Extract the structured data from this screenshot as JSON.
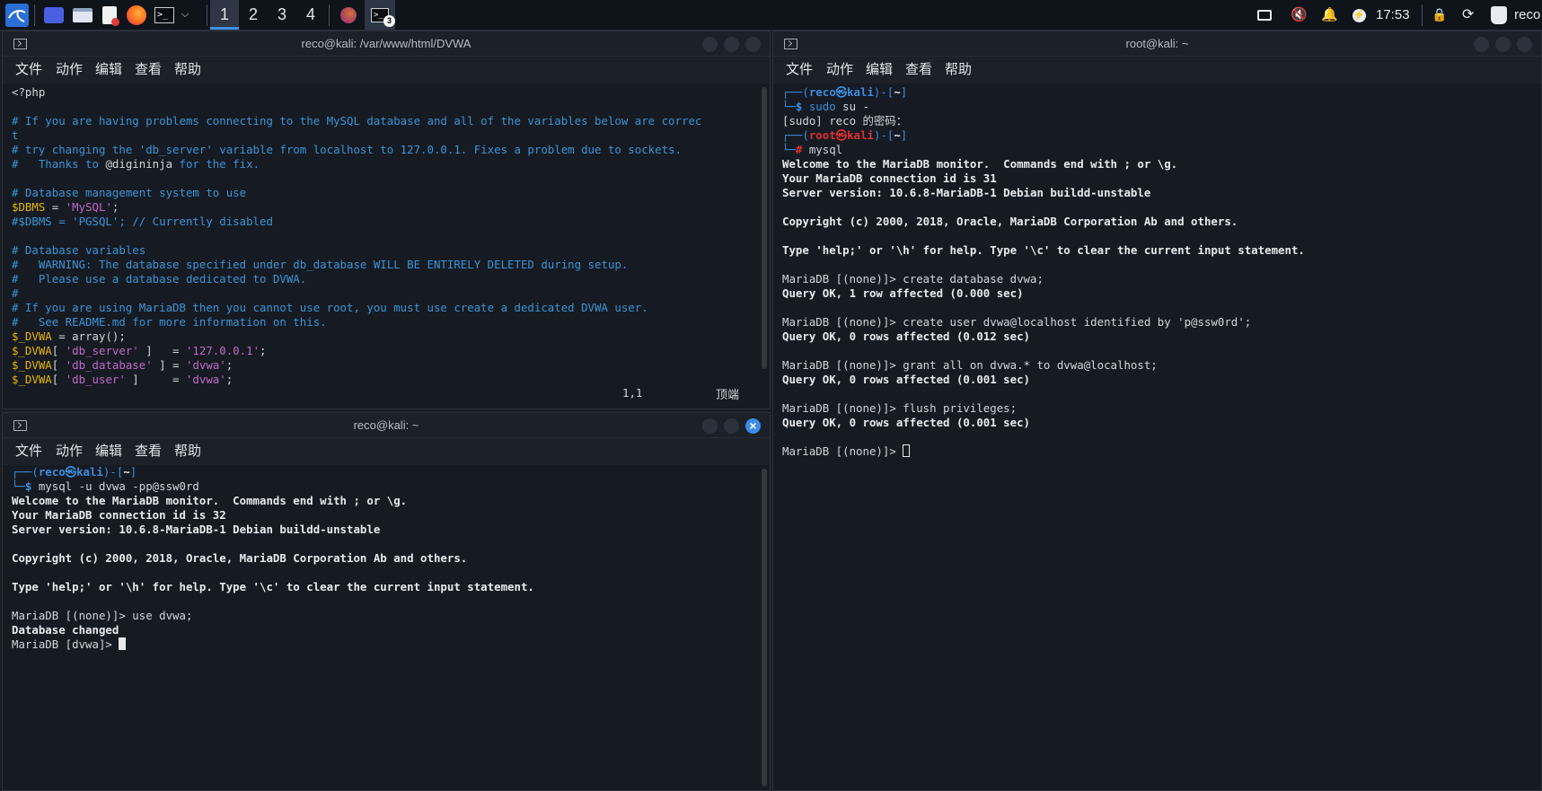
{
  "colors": {
    "accent": "#3f8fe8",
    "comment": "#3a95d6",
    "variable": "#e6b800",
    "string": "#c06ac9",
    "root_prompt": "#e03030"
  },
  "taskbar": {
    "apps": [
      "kali-menu-icon",
      "desktop-icon",
      "file-manager-icon",
      "text-editor-icon",
      "firefox-icon",
      "terminal-icon"
    ],
    "workspaces": [
      "1",
      "2",
      "3",
      "4"
    ],
    "active_workspace": "1",
    "task_badge": "3",
    "tray": {
      "clock": "17:53",
      "user": "reco",
      "icons": [
        "window-icon",
        "mute-icon",
        "bell-icon",
        "power-icon",
        "lock-icon",
        "refresh-icon",
        "user-icon"
      ]
    }
  },
  "menu": [
    "文件",
    "动作",
    "编辑",
    "查看",
    "帮助"
  ],
  "win_editor": {
    "title": "reco@kali: /var/www/html/DVWA",
    "lines": [
      [
        [
          "<?php",
          "c-default"
        ]
      ],
      [
        [
          "",
          "c-default"
        ]
      ],
      [
        [
          "# If you are having problems connecting to the MySQL database and all of the variables below are correc",
          "c-comment"
        ]
      ],
      [
        [
          "t",
          "c-comment"
        ]
      ],
      [
        [
          "# try changing the 'db_server' variable from localhost to 127.0.0.1. Fixes a problem due to sockets.",
          "c-comment"
        ]
      ],
      [
        [
          "#   Thanks to ",
          "c-comment"
        ],
        [
          "@digininja",
          "c-default"
        ],
        [
          " for the fix.",
          "c-comment"
        ]
      ],
      [
        [
          "",
          "c-default"
        ]
      ],
      [
        [
          "# Database management system to use",
          "c-comment"
        ]
      ],
      [
        [
          "$DBMS",
          "c-var"
        ],
        [
          " = ",
          "c-default"
        ],
        [
          "'MySQL'",
          "c-str"
        ],
        [
          ";",
          "c-default"
        ]
      ],
      [
        [
          "#$DBMS = 'PGSQL'; // Currently disabled",
          "c-comment"
        ]
      ],
      [
        [
          "",
          "c-default"
        ]
      ],
      [
        [
          "# Database variables",
          "c-comment"
        ]
      ],
      [
        [
          "#   WARNING: The database specified under db_database WILL BE ENTIRELY DELETED during setup.",
          "c-comment"
        ]
      ],
      [
        [
          "#   Please use a database dedicated to DVWA.",
          "c-comment"
        ]
      ],
      [
        [
          "#",
          "c-comment"
        ]
      ],
      [
        [
          "# If you are using MariaDB then you cannot use root, you must use create a dedicated DVWA user.",
          "c-comment"
        ]
      ],
      [
        [
          "#   See README.md for more information on this.",
          "c-comment"
        ]
      ],
      [
        [
          "$_DVWA",
          "c-var"
        ],
        [
          " = array();",
          "c-default"
        ]
      ],
      [
        [
          "$_DVWA",
          "c-var"
        ],
        [
          "[ ",
          "c-default"
        ],
        [
          "'db_server'",
          "c-str"
        ],
        [
          " ]   = ",
          "c-default"
        ],
        [
          "'127.0.0.1'",
          "c-str"
        ],
        [
          ";",
          "c-default"
        ]
      ],
      [
        [
          "$_DVWA",
          "c-var"
        ],
        [
          "[ ",
          "c-default"
        ],
        [
          "'db_database'",
          "c-str"
        ],
        [
          " ] = ",
          "c-default"
        ],
        [
          "'dvwa'",
          "c-str"
        ],
        [
          ";",
          "c-default"
        ]
      ],
      [
        [
          "$_DVWA",
          "c-var"
        ],
        [
          "[ ",
          "c-default"
        ],
        [
          "'db_user'",
          "c-str"
        ],
        [
          " ]     = ",
          "c-default"
        ],
        [
          "'dvwa'",
          "c-str"
        ],
        [
          ";",
          "c-default"
        ]
      ]
    ],
    "status_pos": "1,1",
    "status_top": "顶端"
  },
  "win_user": {
    "title": "reco@kali: ~",
    "lines": [
      [
        [
          "┌──(",
          "c-prompt"
        ],
        [
          "reco㉿kali",
          "c-user"
        ],
        [
          ")-[",
          "c-prompt"
        ],
        [
          "~",
          "c-bold"
        ],
        [
          "]",
          "c-prompt"
        ]
      ],
      [
        [
          "└─",
          "c-prompt"
        ],
        [
          "$ ",
          "c-user"
        ],
        [
          "mysql",
          "c-default"
        ],
        [
          " -u dvwa ",
          "c-default"
        ],
        [
          "-pp@ssw0rd",
          "c-default"
        ]
      ],
      [
        [
          "Welcome to the MariaDB monitor.  Commands end with ; or \\g.",
          "c-bold"
        ]
      ],
      [
        [
          "Your MariaDB connection id is 32",
          "c-bold"
        ]
      ],
      [
        [
          "Server version: 10.6.8-MariaDB-1 Debian buildd-unstable",
          "c-bold"
        ]
      ],
      [
        [
          "",
          "c-default"
        ]
      ],
      [
        [
          "Copyright (c) 2000, 2018, Oracle, MariaDB Corporation Ab and others.",
          "c-bold"
        ]
      ],
      [
        [
          "",
          "c-default"
        ]
      ],
      [
        [
          "Type 'help;' or '\\h' for help. Type '\\c' to clear the current input statement.",
          "c-bold"
        ]
      ],
      [
        [
          "",
          "c-default"
        ]
      ],
      [
        [
          "MariaDB [(none)]> use dvwa;",
          "c-default"
        ]
      ],
      [
        [
          "Database changed",
          "c-bold"
        ]
      ],
      [
        [
          "MariaDB [dvwa]> ",
          "c-default"
        ]
      ]
    ]
  },
  "win_root": {
    "title": "root@kali: ~",
    "lines": [
      [
        [
          "┌──(",
          "c-prompt"
        ],
        [
          "reco㉿kali",
          "c-user"
        ],
        [
          ")-[",
          "c-prompt"
        ],
        [
          "~",
          "c-bold"
        ],
        [
          "]",
          "c-prompt"
        ]
      ],
      [
        [
          "└─",
          "c-prompt"
        ],
        [
          "$ ",
          "c-user"
        ],
        [
          "sudo",
          "c-cmd"
        ],
        [
          " su -",
          "c-default"
        ]
      ],
      [
        [
          "[sudo] reco 的密码：",
          "c-default"
        ]
      ],
      [
        [
          "┌──(",
          "c-prompt"
        ],
        [
          "root㉿kali",
          "c-root"
        ],
        [
          ")-[",
          "c-prompt"
        ],
        [
          "~",
          "c-bold"
        ],
        [
          "]",
          "c-prompt"
        ]
      ],
      [
        [
          "└─",
          "c-prompt"
        ],
        [
          "# ",
          "c-root"
        ],
        [
          "mysql",
          "c-default"
        ]
      ],
      [
        [
          "Welcome to the MariaDB monitor.  Commands end with ; or \\g.",
          "c-bold"
        ]
      ],
      [
        [
          "Your MariaDB connection id is 31",
          "c-bold"
        ]
      ],
      [
        [
          "Server version: 10.6.8-MariaDB-1 Debian buildd-unstable",
          "c-bold"
        ]
      ],
      [
        [
          "",
          "c-default"
        ]
      ],
      [
        [
          "Copyright (c) 2000, 2018, Oracle, MariaDB Corporation Ab and others.",
          "c-bold"
        ]
      ],
      [
        [
          "",
          "c-default"
        ]
      ],
      [
        [
          "Type 'help;' or '\\h' for help. Type '\\c' to clear the current input statement.",
          "c-bold"
        ]
      ],
      [
        [
          "",
          "c-default"
        ]
      ],
      [
        [
          "MariaDB [(none)]> create database dvwa;",
          "c-default"
        ]
      ],
      [
        [
          "Query OK, 1 row affected (0.000 sec)",
          "c-bold"
        ]
      ],
      [
        [
          "",
          "c-default"
        ]
      ],
      [
        [
          "MariaDB [(none)]> create user dvwa@localhost identified by 'p@ssw0rd';",
          "c-default"
        ]
      ],
      [
        [
          "Query OK, 0 rows affected (0.012 sec)",
          "c-bold"
        ]
      ],
      [
        [
          "",
          "c-default"
        ]
      ],
      [
        [
          "MariaDB [(none)]> grant all on dvwa.* to dvwa@localhost;",
          "c-default"
        ]
      ],
      [
        [
          "Query OK, 0 rows affected (0.001 sec)",
          "c-bold"
        ]
      ],
      [
        [
          "",
          "c-default"
        ]
      ],
      [
        [
          "MariaDB [(none)]> flush privileges;",
          "c-default"
        ]
      ],
      [
        [
          "Query OK, 0 rows affected (0.001 sec)",
          "c-bold"
        ]
      ],
      [
        [
          "",
          "c-default"
        ]
      ],
      [
        [
          "MariaDB [(none)]> ",
          "c-default"
        ]
      ]
    ]
  }
}
